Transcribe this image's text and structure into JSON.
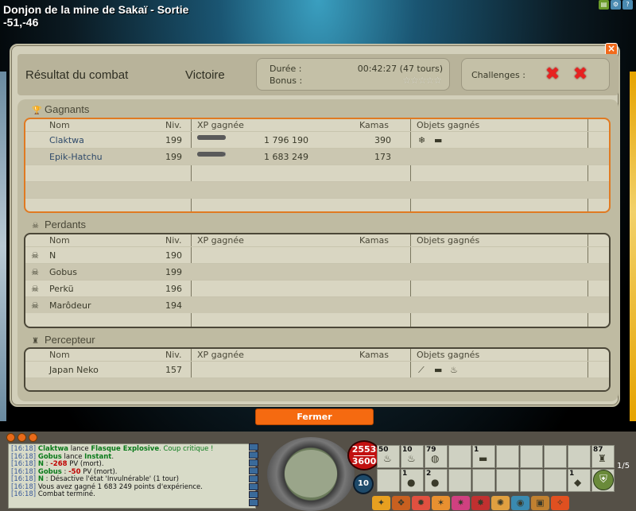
{
  "map": {
    "name": "Donjon de la mine de Sakaï - Sortie",
    "coords": "-51,-46"
  },
  "dialog": {
    "title": "Résultat du combat",
    "result": "Victoire",
    "duration_label": "Durée :",
    "duration_value": "00:42:27 (47 tours)",
    "bonus_label": "Bonus :",
    "bonus_stars": "☆☆☆☆☆",
    "challenges_label": "Challenges :",
    "close_glyph": "×",
    "close_button": "Fermer"
  },
  "columns": {
    "name": "Nom",
    "level": "Niv.",
    "xp": "XP gagnée",
    "kamas": "Kamas",
    "items": "Objets gagnés"
  },
  "winners": {
    "label": "Gagnants",
    "rows": [
      {
        "name": "Claktwa",
        "level": "199",
        "xp": "1 796 190",
        "xp_fill": 1.0,
        "kamas": "390",
        "items": [
          "crystal-icon",
          "scroll-icon"
        ]
      },
      {
        "name": "Epik-Hatchu",
        "level": "199",
        "xp": "1 683 249",
        "xp_fill": 0.94,
        "kamas": "173",
        "items": []
      }
    ]
  },
  "losers": {
    "label": "Perdants",
    "rows": [
      {
        "name": "N",
        "level": "190"
      },
      {
        "name": "Gobus",
        "level": "199"
      },
      {
        "name": "Perkü",
        "level": "196"
      },
      {
        "name": "Marôdeur",
        "level": "194"
      }
    ]
  },
  "collector": {
    "label": "Percepteur",
    "rows": [
      {
        "name": "Japan Neko",
        "level": "157",
        "items": [
          "bone-icon",
          "scroll-icon",
          "potion-icon"
        ]
      }
    ]
  },
  "hud": {
    "hp_current": "2553",
    "hp_max": "3600",
    "level": "10",
    "page": "1/5",
    "inventory": [
      {
        "count": "50",
        "icon": "potion-icon"
      },
      {
        "count": "10",
        "icon": "potion-icon"
      },
      {
        "count": "79",
        "icon": "bread-icon"
      },
      {
        "count": "",
        "icon": ""
      },
      {
        "count": "1",
        "icon": "scroll-icon"
      },
      {
        "count": "",
        "icon": ""
      },
      {
        "count": "",
        "icon": ""
      },
      {
        "count": "",
        "icon": ""
      },
      {
        "count": "",
        "icon": ""
      },
      {
        "count": "87",
        "icon": "bag-icon"
      },
      {
        "count": "",
        "icon": ""
      },
      {
        "count": "1",
        "icon": "pet-icon"
      },
      {
        "count": "2",
        "icon": "pet-icon"
      },
      {
        "count": "",
        "icon": ""
      },
      {
        "count": "",
        "icon": ""
      },
      {
        "count": "",
        "icon": ""
      },
      {
        "count": "",
        "icon": ""
      },
      {
        "count": "",
        "icon": ""
      },
      {
        "count": "1",
        "icon": "gem-icon"
      },
      {
        "count": "",
        "icon": ""
      }
    ]
  },
  "chat": [
    {
      "time": "[16:18]",
      "parts": [
        {
          "t": "Claktwa",
          "c": "g"
        },
        {
          "t": " lance ",
          "c": ""
        },
        {
          "t": "Flasque Explosive",
          "c": "g"
        },
        {
          "t": ". Coup critique !",
          "c": "gtext"
        }
      ]
    },
    {
      "time": "[16:18]",
      "parts": [
        {
          "t": "Gobus",
          "c": "g"
        },
        {
          "t": " lance ",
          "c": ""
        },
        {
          "t": "Instant",
          "c": "g"
        },
        {
          "t": ".",
          "c": ""
        }
      ]
    },
    {
      "time": "[16:18]",
      "parts": [
        {
          "t": "N",
          "c": "g"
        },
        {
          "t": " : ",
          "c": ""
        },
        {
          "t": "-268",
          "c": "r"
        },
        {
          "t": " PV (mort).",
          "c": ""
        }
      ]
    },
    {
      "time": "[16:18]",
      "parts": [
        {
          "t": "Gobus",
          "c": "g"
        },
        {
          "t": " : ",
          "c": ""
        },
        {
          "t": "-50",
          "c": "r"
        },
        {
          "t": " PV (mort).",
          "c": ""
        }
      ]
    },
    {
      "time": "[16:18]",
      "parts": [
        {
          "t": "N",
          "c": "g"
        },
        {
          "t": " : Désactive l'état 'Invulnérable' (1 tour)",
          "c": ""
        }
      ]
    },
    {
      "time": "[16:18]",
      "parts": [
        {
          "t": "Vous avez gagné 1 683 249 points d'expérience.",
          "c": ""
        }
      ]
    },
    {
      "time": "[16:18]",
      "parts": [
        {
          "t": "Combat terminé.",
          "c": ""
        }
      ]
    }
  ]
}
